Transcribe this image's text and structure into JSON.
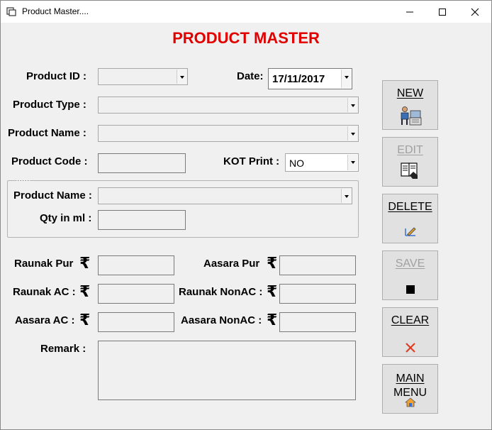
{
  "window": {
    "title": "Product Master....",
    "heading": "PRODUCT MASTER"
  },
  "form": {
    "product_id_label": "Product ID :",
    "product_id_value": "",
    "date_label": "Date:",
    "date_value": "17/11/2017",
    "product_type_label": "Product Type :",
    "product_type_value": "",
    "product_name_label": "Product Name :",
    "product_name_value": "",
    "product_code_label": "Product Code :",
    "product_code_value": "",
    "kot_print_label": "KOT Print :",
    "kot_print_value": "NO",
    "group_caption": "......",
    "group_product_name_label": "Product Name :",
    "group_product_name_value": "",
    "qty_label": "Qty in ml :",
    "qty_value": "",
    "currency_symbol": "₹",
    "raunak_pur_label": "Raunak Pur",
    "aasara_pur_label": "Aasara Pur",
    "raunak_ac_label": "Raunak AC :",
    "raunak_nonac_label": "Raunak NonAC :",
    "aasara_ac_label": "Aasara AC :",
    "aasara_nonac_label": "Aasara NonAC :",
    "remark_label": "Remark :",
    "remark_value": ""
  },
  "buttons": {
    "new": "NEW",
    "edit": "EDIT",
    "delete": "DELETE",
    "save": "SAVE",
    "clear": "CLEAR",
    "main_menu_line1": "MAIN",
    "main_menu_line2": "MENU"
  },
  "icons": {
    "new": "person-at-desk-icon",
    "edit": "hand-on-book-icon",
    "delete": "pencil-ruler-icon",
    "save": "black-square-icon",
    "clear": "red-x-icon",
    "main_menu": "home-icon"
  },
  "colors": {
    "heading": "#e00000",
    "clear_icon": "#e03a1e",
    "disabled_text": "#a0a0a0"
  }
}
